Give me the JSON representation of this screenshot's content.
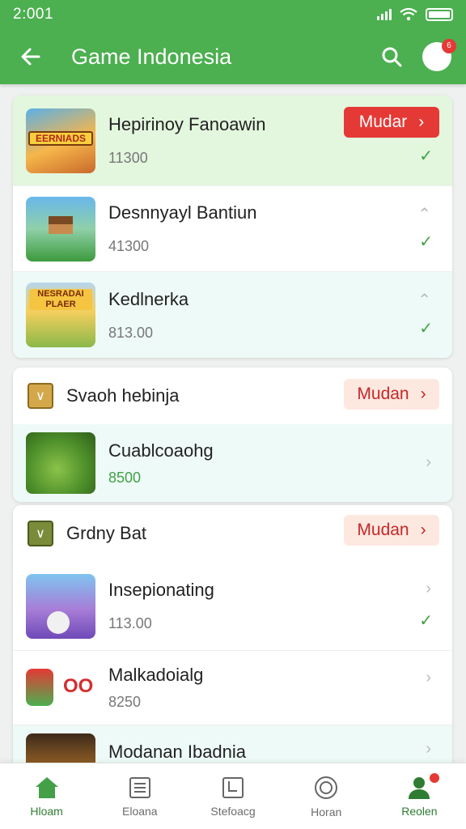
{
  "status": {
    "time": "2:001"
  },
  "appbar": {
    "title": "Game Indonesia",
    "back_icon": "arrow-left-icon",
    "search_icon": "search-icon",
    "badge": "6"
  },
  "card1": {
    "items": [
      {
        "name": "Hepirinoy Fanoawin",
        "count": "11300",
        "action": "Mudar",
        "thumb_text": "EERNIADS"
      },
      {
        "name": "Desnnyayl Bantiun",
        "count": "41300"
      },
      {
        "name": "Kedlnerka",
        "count": "813.00",
        "thumb_text": "NESRADAI PLAER"
      }
    ]
  },
  "card2": {
    "header": {
      "title": "Svaoh hebinja",
      "action": "Mudan"
    },
    "item": {
      "name": "Cuablcoaohg",
      "count": "8500"
    }
  },
  "card3": {
    "header": {
      "title": "Grdny Bat",
      "action": "Mudan"
    },
    "items": [
      {
        "name": "Insepionating",
        "count": "113.00"
      },
      {
        "name": "Malkadoialg",
        "count": "8250",
        "thumb_text": "OO"
      },
      {
        "name": "Modanan Ibadnia",
        "count": ""
      }
    ]
  },
  "nav": [
    {
      "label": "Hloam",
      "icon": "home-icon"
    },
    {
      "label": "Eloana",
      "icon": "list-icon"
    },
    {
      "label": "Stefoacg",
      "icon": "bookmark-icon"
    },
    {
      "label": "Horan",
      "icon": "circle-icon"
    },
    {
      "label": "Reolen",
      "icon": "profile-icon"
    }
  ],
  "colors": {
    "primary": "#4caf50",
    "accent": "#e53935",
    "check": "#43a047"
  }
}
